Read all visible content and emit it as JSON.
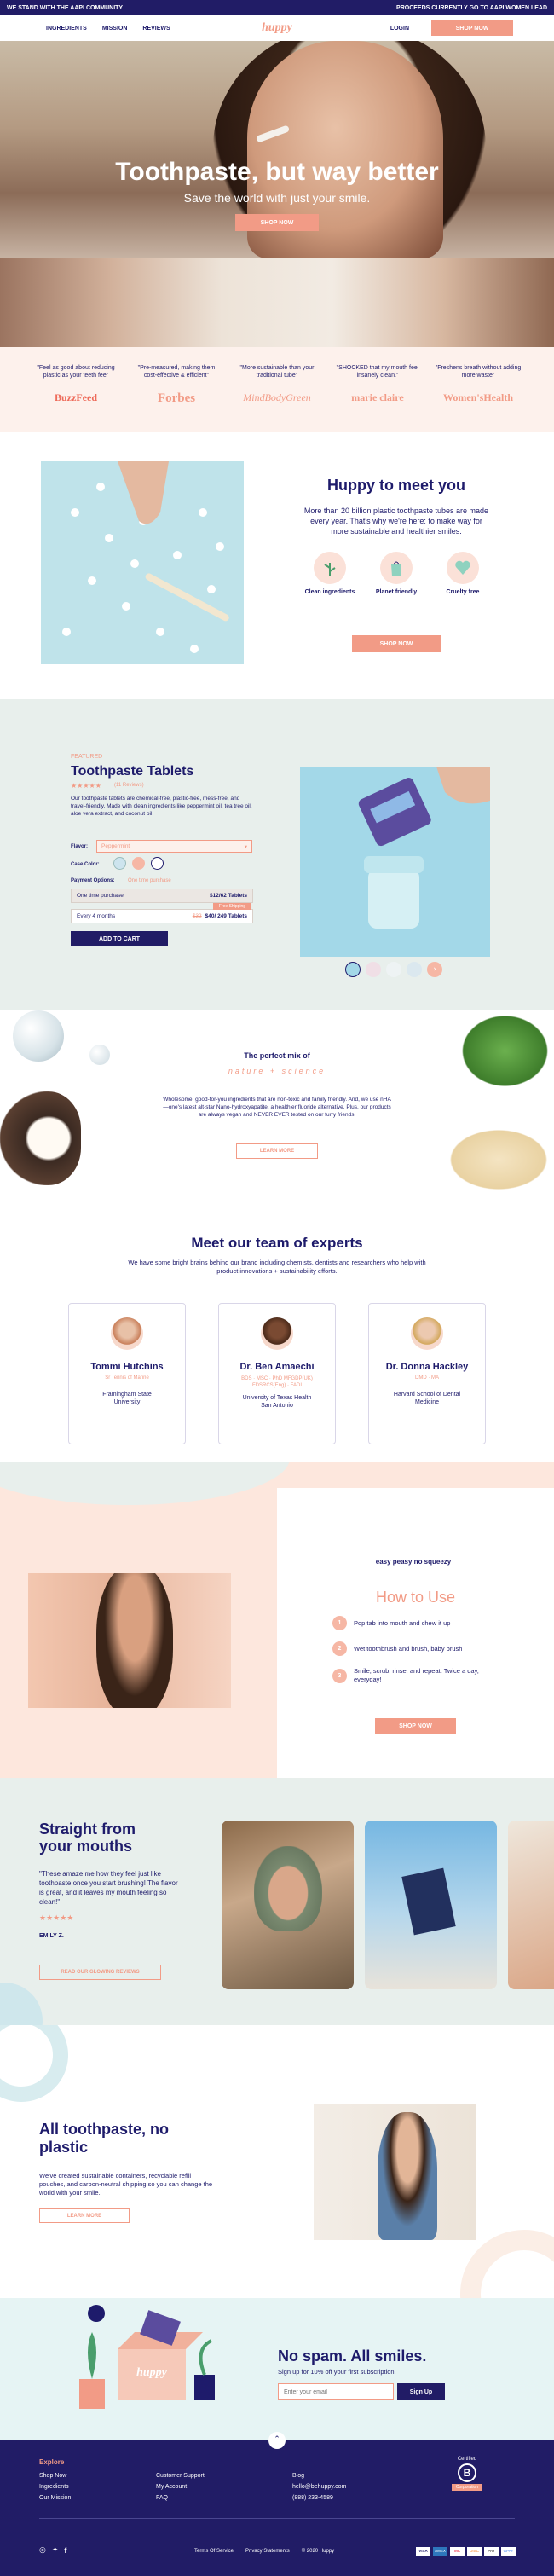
{
  "topbar": {
    "left": "WE STAND WITH THE AAPI COMMUNITY",
    "right": "PROCEEDS CURRENTLY GO TO AAPI WOMEN LEAD"
  },
  "nav": {
    "links": [
      "INGREDIENTS",
      "MISSION",
      "REVIEWS"
    ],
    "logo": "huppy",
    "login": "LOGIN",
    "shop": "SHOP NOW"
  },
  "hero": {
    "title": "Toothpaste, but way better",
    "subtitle": "Save the world with just your smile.",
    "cta": "SHOP NOW"
  },
  "press": [
    {
      "quote": "\"Feel as good about reducing plastic as your teeth fee\"",
      "logo": "BuzzFeed"
    },
    {
      "quote": "\"Pre-measured, making them cost-effective & efficient\"",
      "logo": "Forbes"
    },
    {
      "quote": "\"More sustainable than your traditional tube\"",
      "logo": "MindBodyGreen"
    },
    {
      "quote": "\"SHOCKED that my mouth feel insanely clean.\"",
      "logo": "marie claire"
    },
    {
      "quote": "\"Freshens breath without adding more waste\"",
      "logo": "Women'sHealth"
    }
  ],
  "meet": {
    "title": "Huppy to meet you",
    "text": "More than 20 billion plastic toothpaste tubes are made every year. That's why we're here: to make way for more sustainable and healthier smiles.",
    "features": [
      "Clean ingredients",
      "Planet friendly",
      "Cruelty free"
    ],
    "cta": "SHOP NOW"
  },
  "product": {
    "eyebrow": "FEATURED",
    "name": "Toothpaste Tablets",
    "stars": "★★★★★",
    "reviews": "(11 Reviews)",
    "desc": "Our toothpaste tablets are chemical-free, plastic-free, mess-free, and travel-friendly. Made with clean ingredients like peppermint oil, tea tree oil, aloe vera extract, and coconut oil.",
    "flavor_label": "Flavor:",
    "flavor_value": "Peppermint",
    "case_label": "Case Color:",
    "payment_label": "Payment Options:",
    "payment_note": "One time purchase",
    "opt1_label": "One time purchase",
    "opt1_price": "$12/62 Tablets",
    "opt2_label": "Every 4 months",
    "opt2_old": "$32",
    "opt2_price": "$40/ 249 Tablets",
    "badge": "Free Shipping",
    "cta": "ADD TO CART"
  },
  "mix": {
    "title": "The perfect mix of",
    "arc": "nature + science",
    "text": "Wholesome, good-for-you ingredients that are non-toxic and family friendly. And, we use nHA—one's latest alt-star Nano-hydroxyapatite, a healthier fluoride alternative. Plus, our products are always vegan and NEVER EVER tested on our furry friends.",
    "cta": "LEARN MORE"
  },
  "experts": {
    "title": "Meet our team of experts",
    "text": "We have some bright brains behind our brand including chemists, dentists and researchers who help with product innovations + sustainability efforts.",
    "people": [
      {
        "name": "Tommi Hutchins",
        "role": "Sr Tennis of Marine",
        "school": "Framingham State University"
      },
      {
        "name": "Dr. Ben Amaechi",
        "role": "BDS · MSC · PhD MFGDP(UK) FDSRCS(Eng) · FADI",
        "school": "University of Texas Health San Antonio"
      },
      {
        "name": "Dr. Donna Hackley",
        "role": "DMD · MA",
        "school": "Harvard School of Dental Medicine"
      }
    ]
  },
  "howto": {
    "arc": "easy peasy no squeezy",
    "title": "How to Use",
    "steps": [
      {
        "n": "1",
        "text": "Pop tab into mouth and chew it up"
      },
      {
        "n": "2",
        "text": "Wet toothbrush and brush, baby brush"
      },
      {
        "n": "3",
        "text": "Smile, scrub, rinse, and repeat. Twice a day, everyday!"
      }
    ],
    "cta": "SHOP NOW"
  },
  "reviews": {
    "title": "Straight from your mouths",
    "quote": "\"These amaze me how they feel just like toothpaste once you start brushing! The flavor is great, and it leaves my mouth feeling so clean!\"",
    "stars": "★★★★★",
    "author": "EMILY Z.",
    "cta": "READ OUR GLOWING REVIEWS"
  },
  "plastic": {
    "title": "All toothpaste, no plastic",
    "text": "We've created sustainable containers, recyclable refill pouches, and carbon-neutral shipping so you can change the world with your smile.",
    "cta": "LEARN MORE"
  },
  "signup": {
    "box_logo": "huppy",
    "title": "No spam. All smiles.",
    "text": "Sign up for 10% off your first subscription!",
    "placeholder": "Enter your email",
    "cta": "Sign Up"
  },
  "footer": {
    "explore": "Explore",
    "col1": [
      "Shop Now",
      "Ingredients",
      "Our Mission"
    ],
    "col2": [
      "Customer Support",
      "My Account",
      "FAQ"
    ],
    "col3": [
      "Blog",
      "hello@behuppy.com",
      "(888) 233-4589"
    ],
    "bcorp_top": "Certified",
    "bcorp_bottom": "Corporation",
    "links": [
      "Terms Of Service",
      "Privacy Statements",
      "© 2020 Huppy"
    ],
    "payments": [
      "VISA",
      "AMEX",
      "MC",
      "DISC",
      "PAY",
      "GPAY"
    ]
  },
  "colors": {
    "navy": "#211c66",
    "coral": "#f29b86",
    "peach": "#fdf1ec",
    "mint": "#e7efec"
  }
}
